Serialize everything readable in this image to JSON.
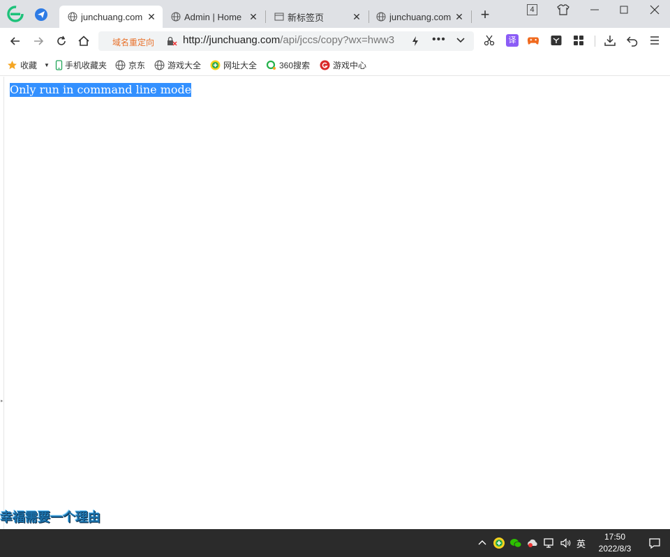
{
  "browser": {
    "tabs": [
      {
        "title": "junchuang.com",
        "active": true
      },
      {
        "title": "Admin | Home",
        "active": false
      },
      {
        "title": "新标签页",
        "active": false
      },
      {
        "title": "junchuang.com",
        "active": false
      }
    ],
    "tab_count": "4",
    "redirect_label": "域名重定向",
    "url_host": "http://junchuang.com",
    "url_path": "/api/jccs/copy?wx=hww3",
    "bookmarks": [
      {
        "label": "收藏",
        "icon": "star-icon"
      },
      {
        "label": "手机收藏夹",
        "icon": "phone-icon"
      },
      {
        "label": "京东",
        "icon": "globe-icon"
      },
      {
        "label": "游戏大全",
        "icon": "globe-icon"
      },
      {
        "label": "网址大全",
        "icon": "plus-circle-icon"
      },
      {
        "label": "360搜索",
        "icon": "search-360-icon"
      },
      {
        "label": "游戏中心",
        "icon": "game-center-icon"
      }
    ],
    "translate_label": "译"
  },
  "page": {
    "message": "Only run in command line mode"
  },
  "overlay": {
    "caption": "幸福需要一个理由"
  },
  "taskbar": {
    "ime_label": "英",
    "time": "17:50",
    "date": "2022/8/3"
  },
  "colors": {
    "selection": "#3390ff",
    "redirect": "#e8712a",
    "tabstrip": "#dfe1e5",
    "taskbar": "#2b2b2b"
  }
}
